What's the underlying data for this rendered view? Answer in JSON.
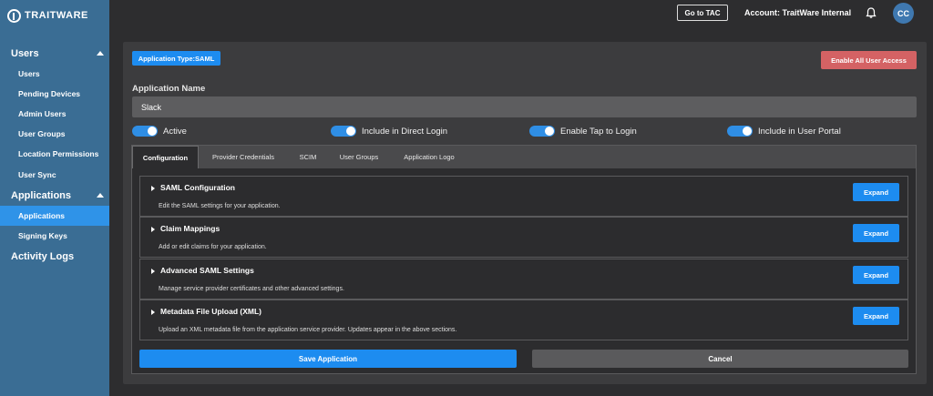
{
  "brand": {
    "logo_text": "TRAITWARE"
  },
  "sidebar": {
    "sections": [
      {
        "label": "Users",
        "items": [
          "Users",
          "Pending Devices",
          "Admin Users",
          "User Groups",
          "Location Permissions",
          "User Sync"
        ]
      },
      {
        "label": "Applications",
        "items": [
          "Applications",
          "Signing Keys"
        ]
      },
      {
        "label": "Activity Logs",
        "items": []
      }
    ],
    "active_item": "Applications"
  },
  "topbar": {
    "tac_button": "Go to TAC",
    "account": "Account: TraitWare Internal",
    "avatar": "CC",
    "bell_icon": "bell-icon"
  },
  "main": {
    "app_type_badge": "Application Type:SAML",
    "enable_all_button": "Enable All User Access",
    "app_name_label": "Application Name",
    "app_name_value": "Slack",
    "toggles": [
      {
        "label": "Active",
        "on": true
      },
      {
        "label": "Include in Direct Login",
        "on": true
      },
      {
        "label": "Enable Tap to Login",
        "on": true
      },
      {
        "label": "Include in User Portal",
        "on": true
      }
    ],
    "tabs": [
      {
        "label": "Configuration",
        "active": true
      },
      {
        "label": "Provider Credentials",
        "active": false
      },
      {
        "label": "SCIM",
        "active": false
      },
      {
        "label": "User Groups",
        "active": false
      },
      {
        "label": "Application Logo",
        "active": false
      }
    ],
    "sections": [
      {
        "title": "SAML Configuration",
        "desc": "Edit the SAML settings for your application.",
        "button": "Expand"
      },
      {
        "title": "Claim Mappings",
        "desc": "Add or edit claims for your application.",
        "button": "Expand"
      },
      {
        "title": "Advanced SAML Settings",
        "desc": "Manage service provider certificates and other advanced settings.",
        "button": "Expand"
      },
      {
        "title": "Metadata File Upload (XML)",
        "desc": "Upload an XML metadata file from the application service provider. Updates appear in the above sections.",
        "button": "Expand"
      }
    ],
    "save_button": "Save Application",
    "cancel_button": "Cancel"
  },
  "colors": {
    "sidebar": "#3a6d94",
    "accent": "#1d8cf0",
    "danger": "#d46264",
    "background": "#2d2d2f"
  }
}
